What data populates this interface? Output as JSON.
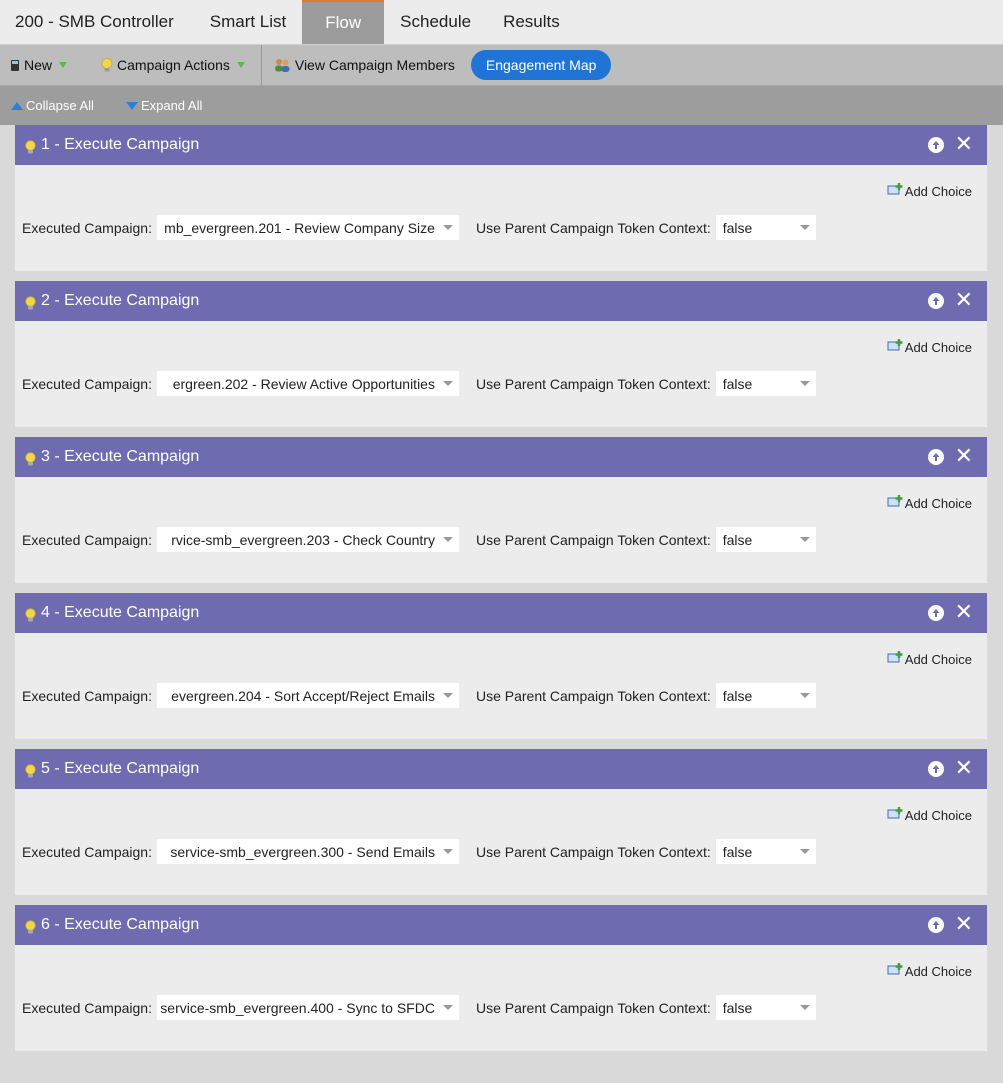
{
  "tabs": [
    {
      "label": "200 - SMB Controller"
    },
    {
      "label": "Smart List"
    },
    {
      "label": "Flow"
    },
    {
      "label": "Schedule"
    },
    {
      "label": "Results"
    }
  ],
  "toolbar": {
    "new_label": "New",
    "campaign_actions_label": "Campaign Actions",
    "view_members_label": "View Campaign Members",
    "engagement_map_label": "Engagement Map"
  },
  "expand_bar": {
    "collapse_label": "Collapse All",
    "expand_label": "Expand All"
  },
  "labels": {
    "add_choice": "Add Choice",
    "executed_campaign": "Executed Campaign:",
    "token_context": "Use Parent Campaign Token Context:"
  },
  "steps": [
    {
      "title": "1 - Execute Campaign",
      "campaign": "mb_evergreen.201 - Review Company Size",
      "token_context": "false"
    },
    {
      "title": "2 - Execute Campaign",
      "campaign": "ergreen.202 - Review Active Opportunities",
      "token_context": "false"
    },
    {
      "title": "3 - Execute Campaign",
      "campaign": "rvice-smb_evergreen.203 - Check Country",
      "token_context": "false"
    },
    {
      "title": "4 - Execute Campaign",
      "campaign": "evergreen.204 - Sort Accept/Reject Emails",
      "token_context": "false"
    },
    {
      "title": "5 - Execute Campaign",
      "campaign": "service-smb_evergreen.300 - Send Emails",
      "token_context": "false"
    },
    {
      "title": "6 - Execute Campaign",
      "campaign": "service-smb_evergreen.400 - Sync to SFDC",
      "token_context": "false"
    }
  ],
  "colors": {
    "step_header": "#6e6bb0",
    "active_tab": "#9b9b9b",
    "accent_pill": "#1f74d6"
  }
}
